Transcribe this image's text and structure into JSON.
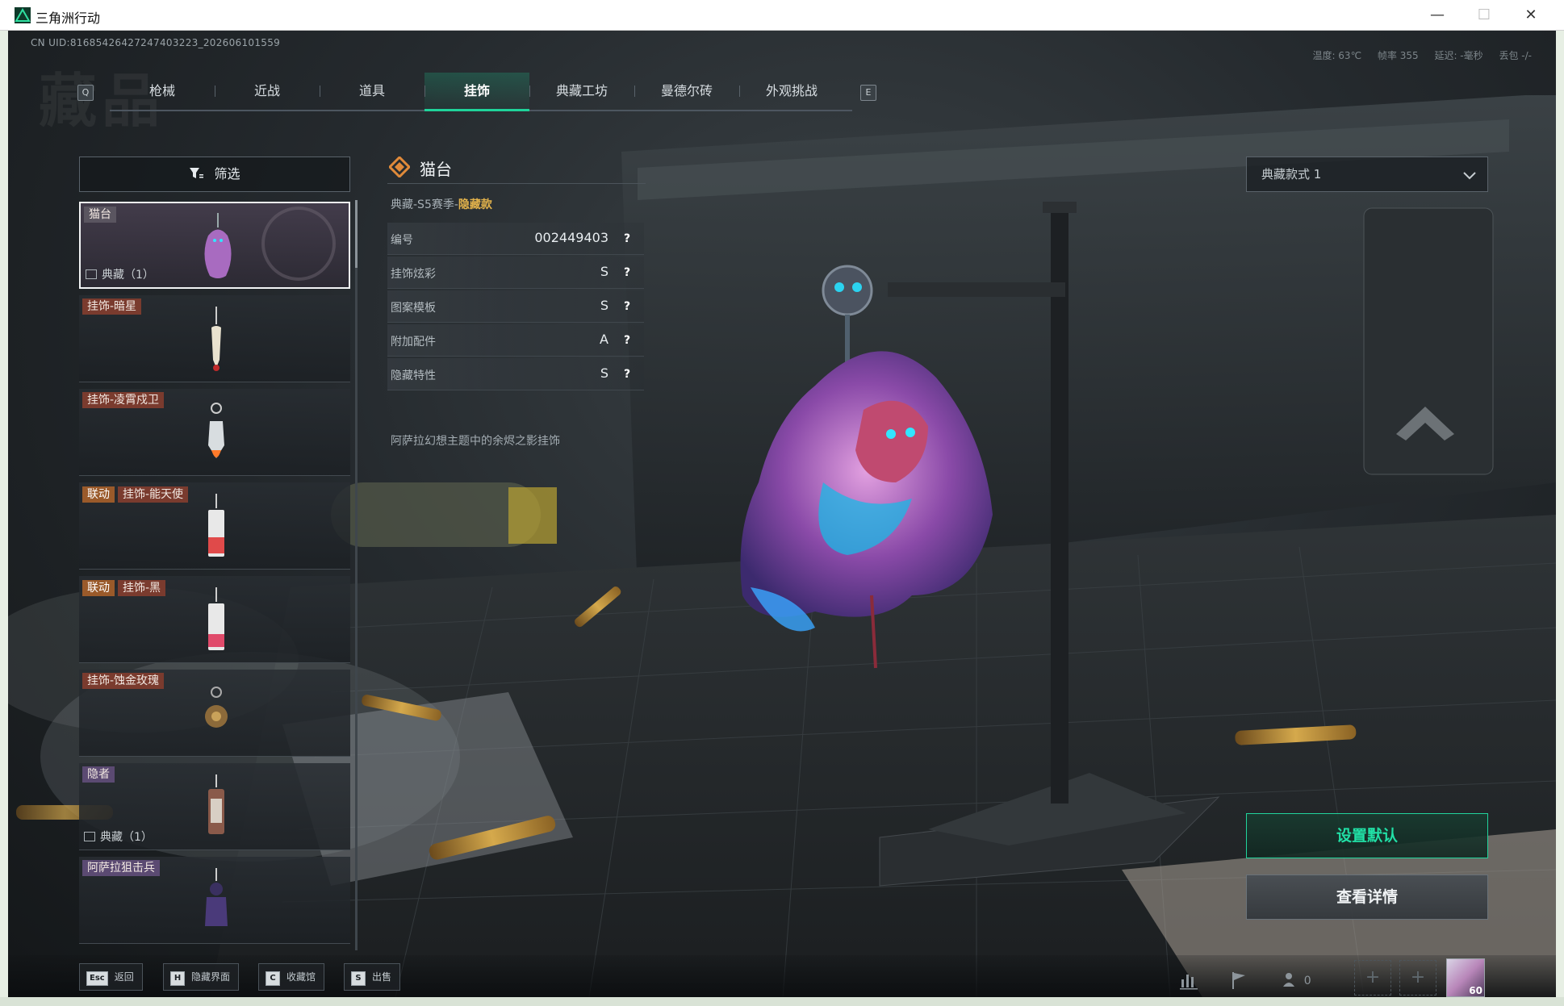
{
  "window": {
    "title": "三角洲行动",
    "controls": {
      "minimize": "—",
      "maximize": "☐",
      "close": "✕"
    }
  },
  "hud": {
    "uid": "CN UID:8168542642724740322​3_202606101559",
    "stats": [
      "温度: 63℃",
      "帧率 355",
      "延迟: -毫秒",
      "丢包 -/-"
    ],
    "watermark": "藏品"
  },
  "tabs": {
    "left_key": "Q",
    "right_key": "E",
    "items": [
      "枪械",
      "近战",
      "道具",
      "挂饰",
      "典藏工坊",
      "曼德尔砖",
      "外观挑战"
    ],
    "active_index": 3
  },
  "filter": {
    "label": "筛选"
  },
  "items": [
    {
      "badge": "猫台",
      "sub": "典藏（1）"
    },
    {
      "badge": "挂饰-暗星"
    },
    {
      "badge": "挂饰-凌霄戍卫"
    },
    {
      "tag": "联动",
      "badge": "挂饰-能天使"
    },
    {
      "tag": "联动",
      "badge": "挂饰-黑"
    },
    {
      "badge": "挂饰-蚀金玫瑰"
    },
    {
      "badge": "隐者",
      "sub": "典藏（1）"
    },
    {
      "badge": "阿萨拉狙击兵"
    }
  ],
  "detail": {
    "name": "猫台",
    "rarity_prefix": "典藏-S5赛季-",
    "rarity_highlight": "隐藏款",
    "attrs": [
      {
        "key": "编号",
        "value": "002449403"
      },
      {
        "key": "挂饰炫彩",
        "value": "S"
      },
      {
        "key": "图案模板",
        "value": "S"
      },
      {
        "key": "附加配件",
        "value": "A"
      },
      {
        "key": "隐藏特性",
        "value": "S"
      }
    ],
    "question_mark": "?",
    "description": "阿萨拉幻想主题中的余烬之影挂饰"
  },
  "style_select": {
    "label": "典藏款式 1"
  },
  "actions": {
    "set_default": "设置默认",
    "view_details": "查看详情"
  },
  "hints": [
    {
      "key": "Esc",
      "label": "返回"
    },
    {
      "key": "H",
      "label": "隐藏界面"
    },
    {
      "key": "C",
      "label": "收藏馆"
    },
    {
      "key": "S",
      "label": "出售"
    }
  ],
  "bottom_right": {
    "friends_count": "0",
    "level": "60"
  },
  "colors": {
    "accent": "#1fd39a",
    "gold": "#e2b24b",
    "tag": "#9a5a2a"
  }
}
